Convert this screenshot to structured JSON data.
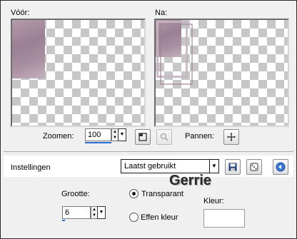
{
  "preview": {
    "before_label": "Vóór:",
    "after_label": "Na:"
  },
  "zoom": {
    "label": "Zoomen:",
    "value": "100",
    "fill_percent": 100
  },
  "pan": {
    "label": "Pannen:"
  },
  "settings": {
    "label": "Instellingen",
    "preset": "Laatst gebruikt"
  },
  "watermark": "Gerrie",
  "size": {
    "label": "Grootte:",
    "value": "6"
  },
  "fill": {
    "transparent_label": "Transparant",
    "solid_label": "Effen kleur",
    "selected": "Transparant",
    "color_label": "Kleur:",
    "color_value": "#ffffff"
  },
  "colors": {
    "accent": "#2a6fd6",
    "image_tint": "#a88ea0"
  }
}
